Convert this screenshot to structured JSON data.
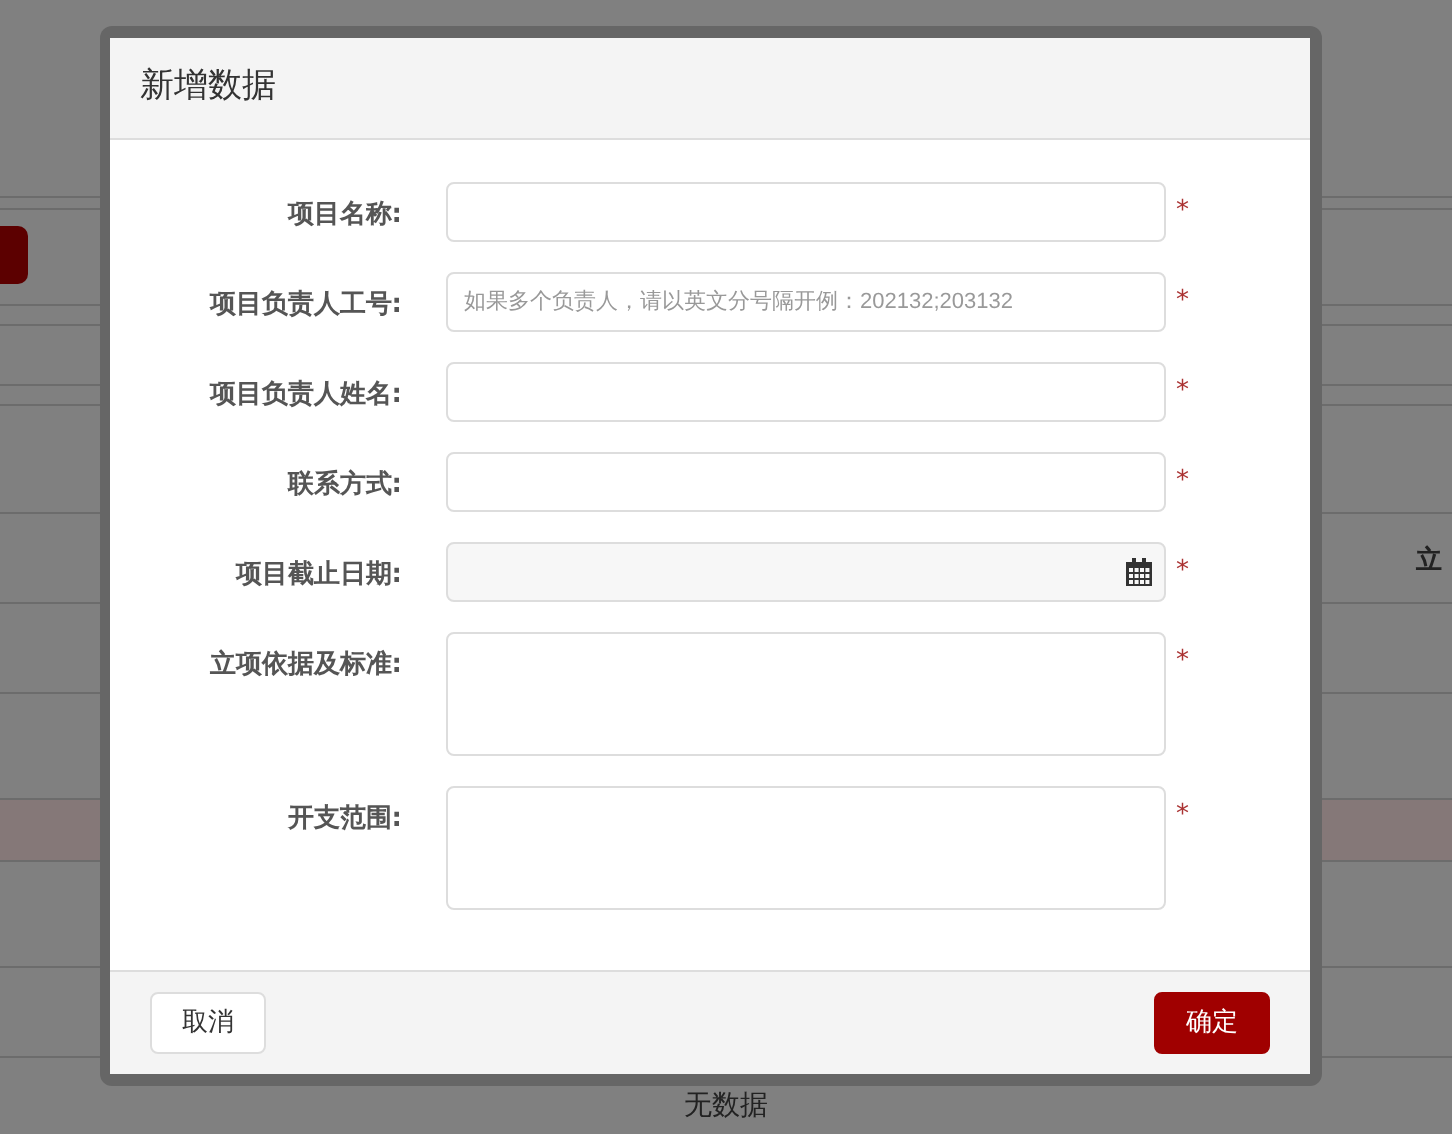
{
  "background": {
    "column_header": "立",
    "empty_text": "无数据"
  },
  "dialog": {
    "title": "新增数据",
    "fields": [
      {
        "label": "项目名称:",
        "kind": "text",
        "required_mark": "*"
      },
      {
        "label": "项目负责人工号:",
        "kind": "text",
        "placeholder": "如果多个负责人，请以英文分号隔开例：202132;203132",
        "required_mark": "*"
      },
      {
        "label": "项目负责人姓名:",
        "kind": "text",
        "required_mark": "*"
      },
      {
        "label": "联系方式:",
        "kind": "text",
        "required_mark": "*"
      },
      {
        "label": "项目截止日期:",
        "kind": "date",
        "required_mark": "*"
      },
      {
        "label": "立项依据及标准:",
        "kind": "textarea",
        "required_mark": "*"
      },
      {
        "label": "开支范围:",
        "kind": "textarea",
        "required_mark": "*"
      }
    ],
    "buttons": [
      {
        "label": "取消",
        "kind": "secondary"
      },
      {
        "label": "确定",
        "kind": "primary"
      }
    ]
  }
}
